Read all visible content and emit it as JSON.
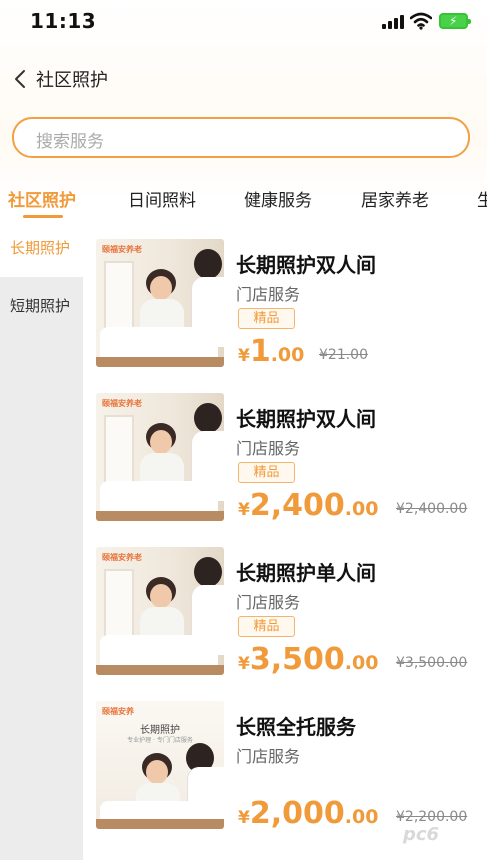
{
  "status_bar": {
    "time": "11:13"
  },
  "nav": {
    "title": "社区照护"
  },
  "search": {
    "placeholder": "搜索服务"
  },
  "tabs": [
    {
      "label": "社区照护",
      "active": true
    },
    {
      "label": "日间照料",
      "active": false
    },
    {
      "label": "健康服务",
      "active": false
    },
    {
      "label": "居家养老",
      "active": false
    },
    {
      "label": "生",
      "active": false
    }
  ],
  "side_menu": [
    {
      "label": "长期照护",
      "active": true
    },
    {
      "label": "短期照护",
      "active": false
    }
  ],
  "products": [
    {
      "title": "长期照护双人间",
      "type": "门店服务",
      "tag": "精品",
      "currency": "¥",
      "price_int": "1",
      "price_dec": ".00",
      "old_price": "¥21.00",
      "image_logo": "颐福安养老",
      "poster_title": "",
      "poster_sub": ""
    },
    {
      "title": "长期照护双人间",
      "type": "门店服务",
      "tag": "精品",
      "currency": "¥",
      "price_int": "2,400",
      "price_dec": ".00",
      "old_price": "¥2,400.00",
      "image_logo": "颐福安养老",
      "poster_title": "",
      "poster_sub": ""
    },
    {
      "title": "长期照护单人间",
      "type": "门店服务",
      "tag": "精品",
      "currency": "¥",
      "price_int": "3,500",
      "price_dec": ".00",
      "old_price": "¥3,500.00",
      "image_logo": "颐福安养老",
      "poster_title": "",
      "poster_sub": ""
    },
    {
      "title": "长照全托服务",
      "type": "门店服务",
      "tag": "",
      "currency": "¥",
      "price_int": "2,000",
      "price_dec": ".00",
      "old_price": "¥2,200.00",
      "image_logo": "颐福安养",
      "poster_title": "长期照护",
      "poster_sub": "专业护理 · 专门门店服务"
    }
  ],
  "watermark": "pc6",
  "colors": {
    "accent": "#f09a3a",
    "side_bg": "#ececec",
    "text": "#222222",
    "muted": "#666666"
  }
}
